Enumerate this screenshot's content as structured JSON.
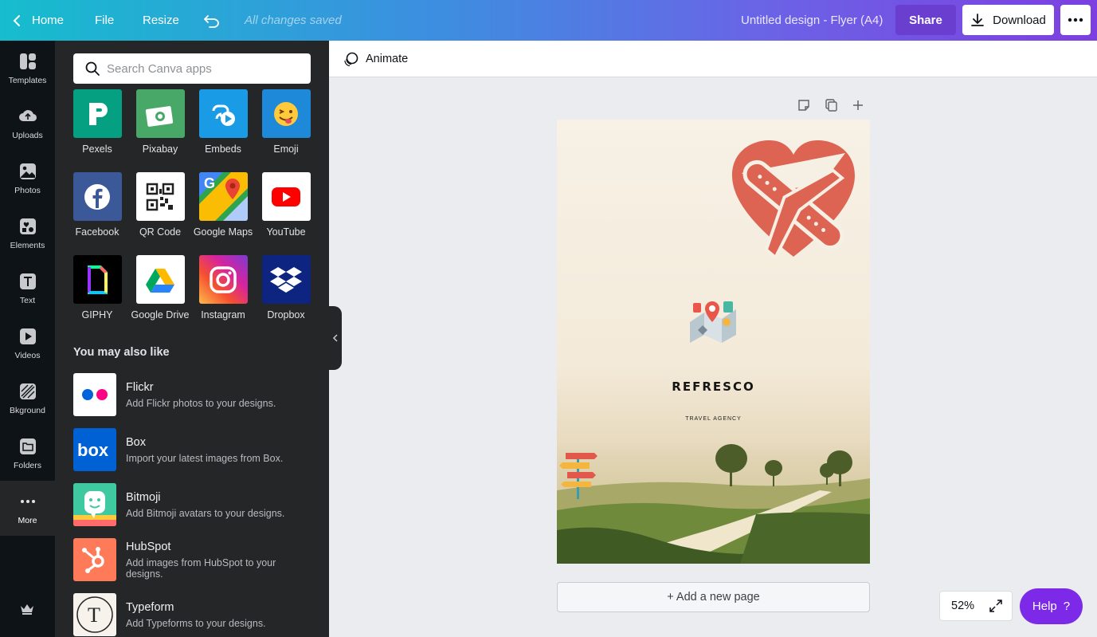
{
  "topbar": {
    "home_label": "Home",
    "file_label": "File",
    "resize_label": "Resize",
    "saved_status": "All changes saved",
    "design_title": "Untitled design - Flyer (A4)",
    "share_label": "Share",
    "download_label": "Download"
  },
  "nav": {
    "items": [
      {
        "label": "Templates",
        "icon": "templates-icon"
      },
      {
        "label": "Uploads",
        "icon": "uploads-icon"
      },
      {
        "label": "Photos",
        "icon": "photos-icon"
      },
      {
        "label": "Elements",
        "icon": "elements-icon"
      },
      {
        "label": "Text",
        "icon": "text-icon"
      },
      {
        "label": "Videos",
        "icon": "videos-icon"
      },
      {
        "label": "Bkground",
        "icon": "background-icon"
      },
      {
        "label": "Folders",
        "icon": "folders-icon"
      },
      {
        "label": "More",
        "icon": "more-dots-icon"
      }
    ]
  },
  "panel": {
    "search_placeholder": "Search Canva apps",
    "apps": [
      {
        "label": "Pexels",
        "color": "#05a081"
      },
      {
        "label": "Pixabay",
        "color": "#48a868"
      },
      {
        "label": "Embeds",
        "color": "#1a9be6"
      },
      {
        "label": "Emoji",
        "color": "#1e88d9"
      },
      {
        "label": "Facebook",
        "color": "#3b5998"
      },
      {
        "label": "QR Code",
        "color": "#ffffff"
      },
      {
        "label": "Google Maps",
        "color": "#4caf50"
      },
      {
        "label": "YouTube",
        "color": "#ffffff"
      },
      {
        "label": "GIPHY",
        "color": "#000000"
      },
      {
        "label": "Google Drive",
        "color": "#ffffff"
      },
      {
        "label": "Instagram",
        "color": "#d6249f"
      },
      {
        "label": "Dropbox",
        "color": "#0d2481"
      }
    ],
    "section_title": "You may also like",
    "recommended": [
      {
        "name": "Flickr",
        "desc": "Add Flickr photos to your designs."
      },
      {
        "name": "Box",
        "desc": "Import your latest images from Box."
      },
      {
        "name": "Bitmoji",
        "desc": "Add Bitmoji avatars to your designs."
      },
      {
        "name": "HubSpot",
        "desc": "Add images from HubSpot to your designs."
      },
      {
        "name": "Typeform",
        "desc": "Add Typeforms to your designs."
      }
    ]
  },
  "workspace": {
    "animate_label": "Animate",
    "page_title": "REFRESCO",
    "page_subtitle": "TRAVEL AGENCY",
    "add_page_label": "+ Add a new page",
    "zoom": "52%",
    "help_label": "Help",
    "help_icon": "?"
  },
  "colors": {
    "accent": "#7d2ae8",
    "share": "#6a3fd0",
    "panel": "#252627",
    "nav": "#0e1318",
    "heart_plane": "#dd6352"
  }
}
